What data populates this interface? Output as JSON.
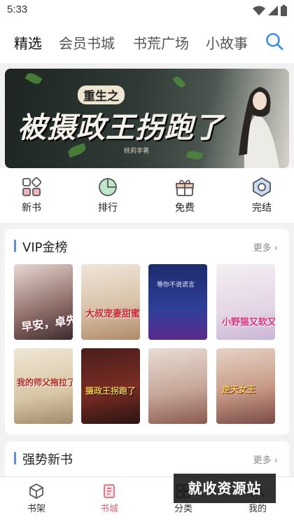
{
  "status_bar": {
    "time": "5:33",
    "icons": [
      "wifi-icon",
      "signal-icon",
      "battery-icon"
    ]
  },
  "top_nav": {
    "tabs": [
      {
        "label": "精选",
        "active": true
      },
      {
        "label": "会员书城",
        "active": false
      },
      {
        "label": "书荒广场",
        "active": false
      },
      {
        "label": "小故事",
        "active": false
      }
    ],
    "search_icon": "search-icon",
    "accent_color": "#3a8ee6"
  },
  "banner": {
    "title_prefix": "重生之",
    "title": "被摄政王拐跑了",
    "author": "桃莉李著"
  },
  "quick_entries": [
    {
      "label": "新书",
      "icon": "new-books-icon"
    },
    {
      "label": "排行",
      "icon": "ranking-icon"
    },
    {
      "label": "免费",
      "icon": "free-gift-icon"
    },
    {
      "label": "完结",
      "icon": "finished-icon"
    }
  ],
  "vip_section": {
    "title": "VIP金榜",
    "more": "更多",
    "covers": [
      {
        "text": "早安，卓先生"
      },
      {
        "text": "大叔宠妻甜蜜蜜"
      },
      {
        "text": "等你不说谎言"
      },
      {
        "text": "小野猫又软又娇"
      },
      {
        "text": "我的师父拖拉了"
      },
      {
        "text": "摄政王拐跑了"
      },
      {
        "text": ""
      },
      {
        "text": "逆天女王"
      }
    ]
  },
  "strong_section": {
    "title": "强势新书",
    "more": "更多"
  },
  "tab_bar": {
    "items": [
      {
        "label": "书架",
        "icon": "bookshelf-icon",
        "active": false
      },
      {
        "label": "书城",
        "icon": "bookstore-icon",
        "active": true
      },
      {
        "label": "分类",
        "icon": "category-icon",
        "active": false
      },
      {
        "label": "我的",
        "icon": "profile-icon",
        "active": false
      }
    ],
    "active_color": "#d9677a"
  },
  "watermark": "就收资源站"
}
